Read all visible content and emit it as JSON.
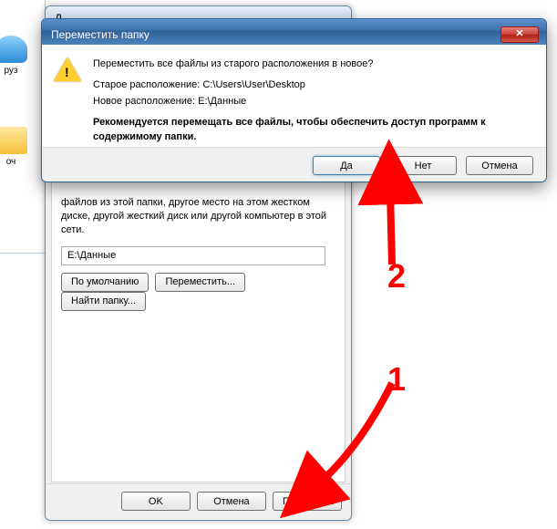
{
  "explorer": {
    "downloads_label": "руз",
    "desktop_label": "оч"
  },
  "props": {
    "title_prefix": "Д",
    "description": "файлов из этой папки, другое место на этом жестком диске, другой жесткий диск или другой компьютер в этой сети.",
    "path_value": "E:\\Данные",
    "btn_default": "По умолчанию",
    "btn_move": "Переместить...",
    "btn_find": "Найти папку...",
    "btn_ok": "OK",
    "btn_cancel": "Отмена",
    "btn_apply": "Применить"
  },
  "modal": {
    "title": "Переместить папку",
    "question": "Переместить все файлы из старого расположения в новое?",
    "old_loc": "Старое расположение: C:\\Users\\User\\Desktop",
    "new_loc": "Новое расположение: E:\\Данные",
    "rec": "Рекомендуется перемещать все файлы, чтобы обеспечить доступ программ к содержимому папки.",
    "btn_yes": "Да",
    "btn_no": "Нет",
    "btn_cancel": "Отмена",
    "close_glyph": "✕"
  },
  "annot": {
    "n1": "1",
    "n2": "2"
  }
}
